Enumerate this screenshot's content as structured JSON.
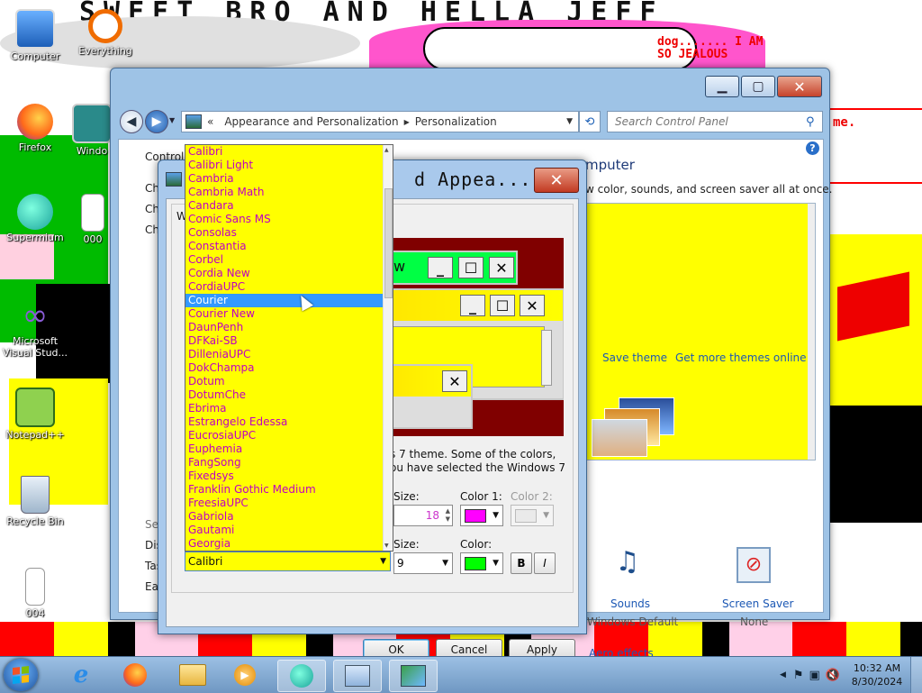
{
  "wallpaper": {
    "banner": "SWEET BRO AND HELLA JEFF",
    "speech": "dog....... I AM SO JEALOUS",
    "side_text": "me.",
    "blocks_bg_colors": [
      "#ff0000",
      "#ffff00",
      "#000000",
      "#ff66cc",
      "#00aa00"
    ]
  },
  "desktop_icons": [
    {
      "label": "Computer",
      "icon": "computer-icon"
    },
    {
      "label": "Everything",
      "icon": "everything-icon"
    },
    {
      "label": "Firefox",
      "icon": "firefox-icon"
    },
    {
      "label": "Windo",
      "icon": "window-icon"
    },
    {
      "label": "Supermium",
      "icon": "supermium-icon"
    },
    {
      "label": "000",
      "icon": "file-icon"
    },
    {
      "label": "Microsoft Visual Stud...",
      "icon": "visual-studio-icon"
    },
    {
      "label": "Notepad++",
      "icon": "notepadpp-icon"
    },
    {
      "label": "Recycle Bin",
      "icon": "recycle-bin-icon"
    },
    {
      "label": "004",
      "icon": "file-icon"
    }
  ],
  "control_panel": {
    "breadcrumb": [
      "Appearance and Personalization",
      "Personalization"
    ],
    "breadcrumb_prefix": "«",
    "search_placeholder": "Search Control Panel",
    "left_partial": [
      "Control P",
      "Ch",
      "Ch",
      "Ch",
      "See",
      "Dis",
      "Tas",
      "Eas"
    ],
    "heading_partial": "mputer",
    "subtitle_partial": "w color, sounds, and screen saver all at once.",
    "save_theme": "Save theme",
    "more_themes": "Get more themes online",
    "sounds_label": "Sounds",
    "sounds_value": "Windows Default",
    "screensaver_label": "Screen Saver",
    "screensaver_value": "None",
    "aero_link": "Aero effects"
  },
  "dialog": {
    "title": "d Appea...",
    "tab_partial": "W",
    "preview_window_text": "w",
    "note_line1": "s 7 theme.  Some of the colors,",
    "note_line2": "ou have selected the Windows 7",
    "size_label_1": "Size:",
    "size_value_1": "18",
    "color1_label": "Color 1:",
    "color2_label": "Color 2:",
    "size_label_2": "Size:",
    "size_value_2": "9",
    "color_label": "Color:",
    "color1_hex": "#ff00ff",
    "color_hex": "#00ff00",
    "bold": "B",
    "italic": "I",
    "ok": "OK",
    "cancel": "Cancel",
    "apply": "Apply",
    "font_combo_value": "Calibri",
    "fonts": [
      "Calibri",
      "Calibri Light",
      "Cambria",
      "Cambria Math",
      "Candara",
      "Comic Sans MS",
      "Consolas",
      "Constantia",
      "Corbel",
      "Cordia New",
      "CordiaUPC",
      "Courier",
      "Courier New",
      "DaunPenh",
      "DFKai-SB",
      "DilleniaUPC",
      "DokChampa",
      "Dotum",
      "DotumChe",
      "Ebrima",
      "Estrangelo Edessa",
      "EucrosiaUPC",
      "Euphemia",
      "FangSong",
      "Fixedsys",
      "Franklin Gothic Medium",
      "FreesiaUPC",
      "Gabriola",
      "Gautami",
      "Georgia"
    ],
    "selected_font": "Courier"
  },
  "taskbar": {
    "time": "10:32 AM",
    "date": "8/30/2024"
  }
}
